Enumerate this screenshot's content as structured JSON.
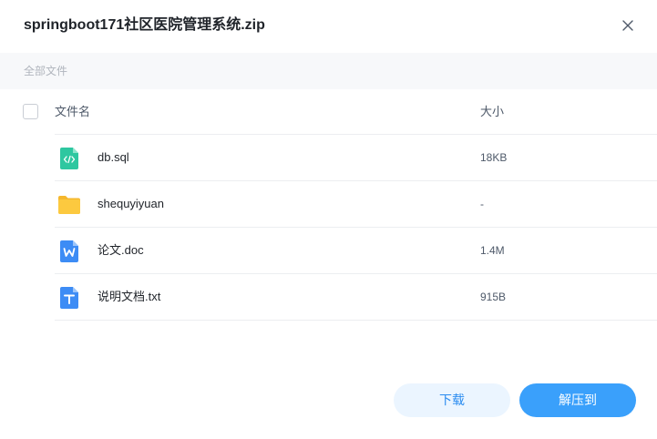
{
  "dialog": {
    "title": "springboot171社区医院管理系统.zip"
  },
  "breadcrumb": {
    "label": "全部文件"
  },
  "table": {
    "columns": {
      "name": "文件名",
      "size": "大小"
    },
    "rows": [
      {
        "name": "db.sql",
        "size": "18KB",
        "icon": "sql-file-icon"
      },
      {
        "name": "shequyiyuan",
        "size": "-",
        "icon": "folder-icon"
      },
      {
        "name": "论文.doc",
        "size": "1.4M",
        "icon": "word-doc-icon"
      },
      {
        "name": "说明文档.txt",
        "size": "915B",
        "icon": "text-file-icon"
      }
    ]
  },
  "buttons": {
    "download": "下载",
    "extract": "解压到"
  },
  "colors": {
    "accent": "#3aa0fb",
    "download_bg": "#ebf5ff",
    "sql_icon": "#2ec7a0",
    "folder_icon": "#fcc43d",
    "doc_icon": "#3d8cf5"
  }
}
